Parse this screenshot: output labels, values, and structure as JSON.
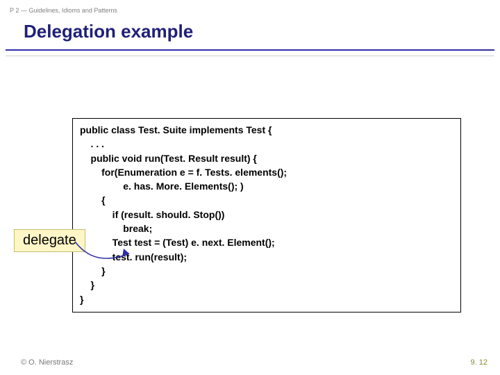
{
  "header": {
    "breadcrumb": "P 2 — Guidelines, Idioms and Patterns",
    "title": "Delegation example"
  },
  "code": {
    "l0": "public class Test. Suite implements Test {",
    "l1": "    . . .",
    "l2": "    public void run(Test. Result result) {",
    "l3": "        for(Enumeration e = f. Tests. elements();",
    "l4": "                e. has. More. Elements(); )",
    "l5": "        {",
    "l6": "            if (result. should. Stop())",
    "l7": "                break;",
    "l8": "            Test test = (Test) e. next. Element();",
    "l9": "            test. run(result);",
    "l10": "        }",
    "l11": "    }",
    "l12": "}"
  },
  "callout": {
    "label": "delegate"
  },
  "footer": {
    "left": "© O. Nierstrasz",
    "right": "9. 12"
  }
}
